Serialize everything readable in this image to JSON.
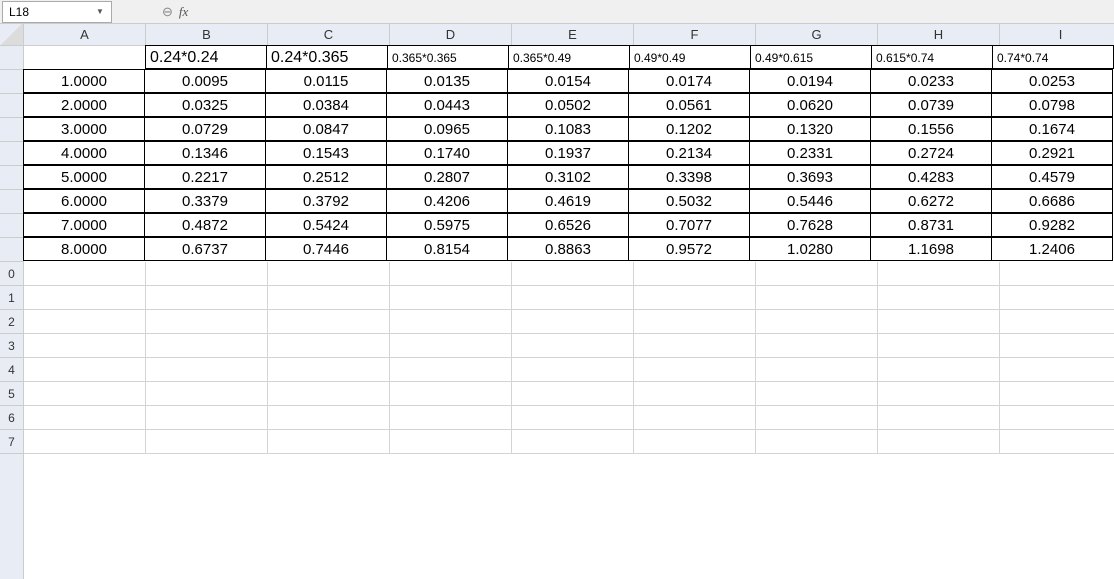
{
  "formulaBar": {
    "nameBox": "L18",
    "fxLabel": "fx"
  },
  "columns": [
    "A",
    "B",
    "C",
    "D",
    "E",
    "F",
    "G",
    "H",
    "I"
  ],
  "rowNumbers": [
    "",
    "",
    "",
    "",
    "",
    "",
    "",
    "",
    "",
    "0",
    "1",
    "2",
    "3",
    "4",
    "5",
    "6",
    "7"
  ],
  "headerRow": {
    "A": "",
    "B": "0.24*0.24",
    "C": "0.24*0.365",
    "D": "0.365*0.365",
    "E": "0.365*0.49",
    "F": "0.49*0.49",
    "G": "0.49*0.615",
    "H": "0.615*0.74",
    "I": "0.74*0.74"
  },
  "chart_data": {
    "type": "table",
    "columns": [
      "A",
      "B",
      "C",
      "D",
      "E",
      "F",
      "G",
      "H",
      "I"
    ],
    "column_labels": [
      "",
      "0.24*0.24",
      "0.24*0.365",
      "0.365*0.365",
      "0.365*0.49",
      "0.49*0.49",
      "0.49*0.615",
      "0.615*0.74",
      "0.74*0.74"
    ],
    "rows": [
      {
        "A": "1.0000",
        "B": "0.0095",
        "C": "0.0115",
        "D": "0.0135",
        "E": "0.0154",
        "F": "0.0174",
        "G": "0.0194",
        "H": "0.0233",
        "I": "0.0253"
      },
      {
        "A": "2.0000",
        "B": "0.0325",
        "C": "0.0384",
        "D": "0.0443",
        "E": "0.0502",
        "F": "0.0561",
        "G": "0.0620",
        "H": "0.0739",
        "I": "0.0798"
      },
      {
        "A": "3.0000",
        "B": "0.0729",
        "C": "0.0847",
        "D": "0.0965",
        "E": "0.1083",
        "F": "0.1202",
        "G": "0.1320",
        "H": "0.1556",
        "I": "0.1674"
      },
      {
        "A": "4.0000",
        "B": "0.1346",
        "C": "0.1543",
        "D": "0.1740",
        "E": "0.1937",
        "F": "0.2134",
        "G": "0.2331",
        "H": "0.2724",
        "I": "0.2921"
      },
      {
        "A": "5.0000",
        "B": "0.2217",
        "C": "0.2512",
        "D": "0.2807",
        "E": "0.3102",
        "F": "0.3398",
        "G": "0.3693",
        "H": "0.4283",
        "I": "0.4579"
      },
      {
        "A": "6.0000",
        "B": "0.3379",
        "C": "0.3792",
        "D": "0.4206",
        "E": "0.4619",
        "F": "0.5032",
        "G": "0.5446",
        "H": "0.6272",
        "I": "0.6686"
      },
      {
        "A": "7.0000",
        "B": "0.4872",
        "C": "0.5424",
        "D": "0.5975",
        "E": "0.6526",
        "F": "0.7077",
        "G": "0.7628",
        "H": "0.8731",
        "I": "0.9282"
      },
      {
        "A": "8.0000",
        "B": "0.6737",
        "C": "0.7446",
        "D": "0.8154",
        "E": "0.8863",
        "F": "0.9572",
        "G": "1.0280",
        "H": "1.1698",
        "I": "1.2406"
      }
    ]
  },
  "headerSizeClass": {
    "B": "hdr-med",
    "C": "hdr-med",
    "D": "hdr-small",
    "E": "hdr-small",
    "F": "hdr-small",
    "G": "hdr-small",
    "H": "hdr-small",
    "I": "hdr-small"
  },
  "emptyRowsAfter": 8
}
